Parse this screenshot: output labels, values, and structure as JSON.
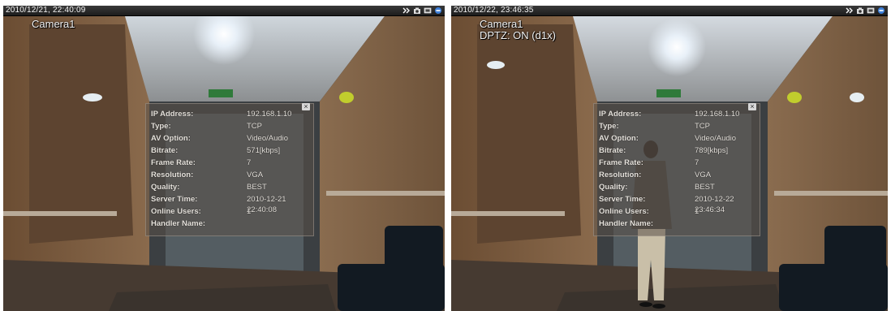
{
  "left_view": {
    "timestamp": "2010/12/21, 22:40:09",
    "camera_name": "Camera1",
    "info": {
      "rows": [
        {
          "label": "IP Address:",
          "value": "192.168.1.10"
        },
        {
          "label": "Type:",
          "value": "TCP"
        },
        {
          "label": "AV Option:",
          "value": "Video/Audio"
        },
        {
          "label": "Bitrate:",
          "value": "571[kbps]"
        },
        {
          "label": "Frame Rate:",
          "value": "7"
        },
        {
          "label": "Resolution:",
          "value": "VGA"
        },
        {
          "label": "Quality:",
          "value": "BEST"
        },
        {
          "label": "Server Time:",
          "value": "2010-12-21 22:40:08"
        },
        {
          "label": "Online Users:",
          "value": "1"
        },
        {
          "label": "Handler Name:",
          "value": ""
        }
      ]
    }
  },
  "right_view": {
    "timestamp": "2010/12/22, 23:46:35",
    "camera_name": "Camera1",
    "dptz_status": "DPTZ: ON (d1x)",
    "info": {
      "rows": [
        {
          "label": "IP Address:",
          "value": "192.168.1.10"
        },
        {
          "label": "Type:",
          "value": "TCP"
        },
        {
          "label": "AV Option:",
          "value": "Video/Audio"
        },
        {
          "label": "Bitrate:",
          "value": "789[kbps]"
        },
        {
          "label": "Frame Rate:",
          "value": "7"
        },
        {
          "label": "Resolution:",
          "value": "VGA"
        },
        {
          "label": "Quality:",
          "value": "BEST"
        },
        {
          "label": "Server Time:",
          "value": "2010-12-22 23:46:34"
        },
        {
          "label": "Online Users:",
          "value": "1"
        },
        {
          "label": "Handler Name:",
          "value": ""
        }
      ]
    }
  },
  "toolbar_icons": [
    "expand-icon",
    "snapshot-camera-icon",
    "record-icon",
    "info-icon"
  ],
  "close_glyph": "×",
  "colors": {
    "titlebar": "#2a2a2a",
    "panel": "#5a5048",
    "wall": "#7a5c3e"
  }
}
